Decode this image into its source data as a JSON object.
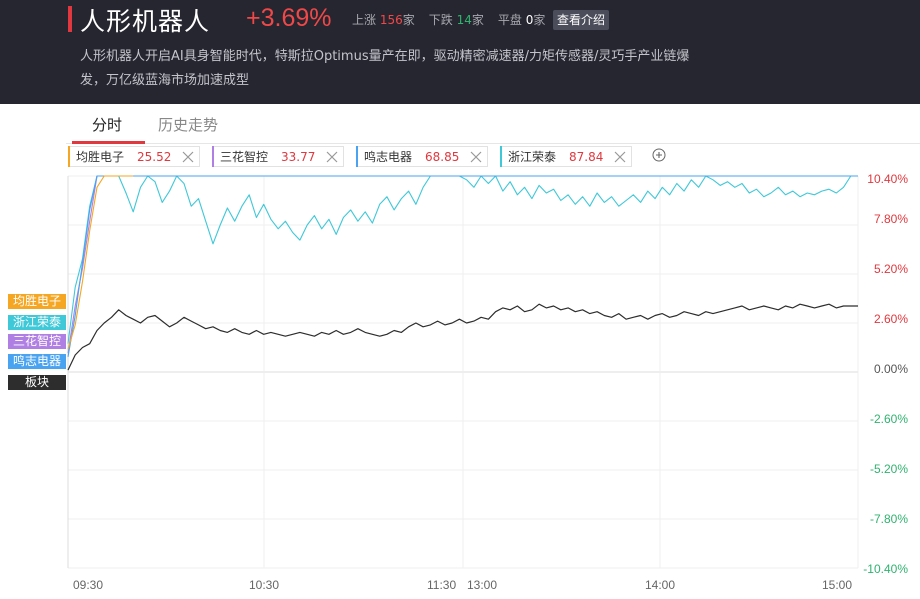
{
  "header": {
    "title": "人形机器人",
    "change_pct": "+3.69%",
    "stats": {
      "up_label": "上涨",
      "up_count": "156",
      "up_unit": "家",
      "down_label": "下跌",
      "down_count": "14",
      "down_unit": "家",
      "flat_label": "平盘",
      "flat_count": "0",
      "flat_unit": "家"
    },
    "intro_button": "查看介绍",
    "description": "人形机器人开启AI具身智能时代，特斯拉Optimus量产在即，驱动精密减速器/力矩传感器/灵巧手产业链爆发，万亿级蓝海市场加速成型"
  },
  "tabs": [
    {
      "label": "分时",
      "active": true
    },
    {
      "label": "历史走势",
      "active": false
    }
  ],
  "compare_chips": [
    {
      "name": "均胜电子",
      "price": "25.52",
      "color": "#f5a623"
    },
    {
      "name": "三花智控",
      "price": "33.77",
      "color": "#b07fe3"
    },
    {
      "name": "鸣志电器",
      "price": "68.85",
      "color": "#4aa3f0"
    },
    {
      "name": "浙江荣泰",
      "price": "87.84",
      "color": "#3ec8d8"
    }
  ],
  "legend": [
    {
      "label": "均胜电子",
      "color": "#f5a623"
    },
    {
      "label": "浙江荣泰",
      "color": "#3ec8d8"
    },
    {
      "label": "三花智控",
      "color": "#b07fe3"
    },
    {
      "label": "鸣志电器",
      "color": "#4aa3f0"
    },
    {
      "label": "板块",
      "color": "#2d2d2d"
    }
  ],
  "chart_data": {
    "type": "line",
    "y_ticks": [
      "10.40%",
      "7.80%",
      "5.20%",
      "2.60%",
      "0.00%",
      "-2.60%",
      "-5.20%",
      "-7.80%",
      "-10.40%"
    ],
    "ylim": [
      -10.4,
      10.4
    ],
    "x_ticks": [
      "09:30",
      "10:30",
      "11:30",
      "13:00",
      "14:00",
      "15:00"
    ],
    "series": [
      {
        "name": "板块",
        "color": "#2d2d2d",
        "values": [
          0.1,
          0.9,
          1.3,
          1.5,
          2.2,
          2.6,
          2.9,
          3.3,
          3.0,
          2.8,
          2.6,
          2.9,
          3.0,
          2.7,
          2.4,
          2.6,
          2.9,
          2.7,
          2.5,
          2.3,
          2.4,
          2.2,
          2.1,
          2.3,
          2.1,
          2.0,
          2.2,
          2.0,
          2.1,
          2.0,
          1.9,
          2.0,
          2.1,
          2.0,
          1.9,
          2.1,
          2.0,
          2.2,
          2.0,
          2.1,
          2.3,
          2.1,
          2.0,
          1.9,
          2.0,
          2.2,
          2.1,
          2.4,
          2.6,
          2.4,
          2.5,
          2.7,
          2.5,
          2.6,
          2.8,
          2.6,
          2.7,
          2.9,
          2.8,
          3.2,
          3.4,
          3.3,
          3.5,
          3.2,
          3.3,
          3.6,
          3.4,
          3.5,
          3.3,
          3.4,
          3.2,
          3.3,
          3.1,
          3.2,
          3.0,
          2.9,
          3.1,
          2.8,
          2.9,
          3.0,
          2.8,
          3.0,
          3.1,
          2.9,
          3.0,
          3.2,
          3.1,
          3.0,
          3.2,
          3.1,
          3.2,
          3.3,
          3.4,
          3.5,
          3.3,
          3.4,
          3.5,
          3.4,
          3.3,
          3.5,
          3.4,
          3.6,
          3.5,
          3.4,
          3.5,
          3.6,
          3.4,
          3.5,
          3.5,
          3.5
        ]
      },
      {
        "name": "浙江荣泰",
        "color": "#3ec8d8",
        "values": [
          1.5,
          4.5,
          6.0,
          8.8,
          10.4,
          10.4,
          10.4,
          10.4,
          9.5,
          8.5,
          9.8,
          10.4,
          10.1,
          9.0,
          9.6,
          10.4,
          10.0,
          8.8,
          9.2,
          8.0,
          6.8,
          7.8,
          8.7,
          8.0,
          8.8,
          9.4,
          8.2,
          8.9,
          8.1,
          7.6,
          8.0,
          7.4,
          7.0,
          7.8,
          8.3,
          7.6,
          8.1,
          7.3,
          8.2,
          8.6,
          8.0,
          8.5,
          7.9,
          8.9,
          9.3,
          8.6,
          9.2,
          9.6,
          8.9,
          9.8,
          10.4,
          10.4,
          10.4,
          10.4,
          10.4,
          10.2,
          9.8,
          10.4,
          10.0,
          10.4,
          9.6,
          10.1,
          9.4,
          9.8,
          9.2,
          9.9,
          9.5,
          9.7,
          9.1,
          9.4,
          8.9,
          9.3,
          8.8,
          9.5,
          9.0,
          9.3,
          8.8,
          9.1,
          9.4,
          9.0,
          9.6,
          9.2,
          9.8,
          9.4,
          10.0,
          9.6,
          10.2,
          9.8,
          10.4,
          10.2,
          9.9,
          10.1,
          9.8,
          10.0,
          9.5,
          9.7,
          9.3,
          9.5,
          9.8,
          9.4,
          9.6,
          9.3,
          9.5,
          9.4,
          9.6,
          9.7,
          9.5,
          9.8,
          10.4,
          10.4
        ]
      },
      {
        "name": "三花智控",
        "color": "#b07fe3",
        "values": [
          1.0,
          3.5,
          5.5,
          8.0,
          10.4,
          10.4,
          10.4,
          10.4,
          10.4,
          10.4,
          10.4,
          10.4,
          10.4,
          10.4,
          10.4,
          10.4,
          10.4,
          10.4,
          10.4,
          10.4,
          10.4
        ]
      },
      {
        "name": "鸣志电器",
        "color": "#4aa3f0",
        "values": [
          0.8,
          3.0,
          5.8,
          8.6,
          10.4,
          10.4,
          10.4,
          10.4,
          10.4,
          10.4,
          10.4,
          10.4,
          10.4,
          10.4,
          10.4,
          10.4,
          10.4,
          10.4,
          10.4,
          10.4,
          10.4,
          10.4,
          10.4,
          10.4,
          10.4,
          10.4,
          10.4,
          10.4,
          10.4,
          10.4,
          10.4,
          10.4,
          10.4,
          10.4,
          10.4,
          10.4,
          10.4,
          10.4,
          10.4,
          10.4,
          10.4,
          10.4,
          10.4,
          10.4,
          10.4,
          10.4,
          10.4,
          10.4,
          10.4,
          10.4,
          10.4,
          10.4,
          10.4,
          10.4,
          10.4,
          10.4,
          10.4,
          10.4,
          10.4,
          10.4,
          10.4,
          10.4,
          10.4,
          10.4,
          10.4,
          10.4,
          10.4,
          10.4,
          10.4,
          10.4,
          10.4,
          10.4,
          10.4,
          10.4,
          10.4,
          10.4,
          10.4,
          10.4,
          10.4,
          10.4,
          10.4,
          10.4,
          10.4,
          10.4,
          10.4,
          10.4,
          10.4,
          10.4,
          10.4,
          10.4,
          10.4,
          10.4,
          10.4,
          10.4,
          10.4,
          10.4,
          10.4,
          10.4,
          10.4,
          10.4,
          10.4,
          10.4,
          10.4,
          10.4,
          10.4,
          10.4,
          10.4,
          10.4,
          10.4,
          10.4
        ]
      },
      {
        "name": "均胜电子",
        "color": "#f5a623",
        "values": [
          1.2,
          2.5,
          4.8,
          7.5,
          9.8,
          10.4,
          10.4,
          10.4,
          10.4,
          10.4
        ]
      }
    ]
  }
}
